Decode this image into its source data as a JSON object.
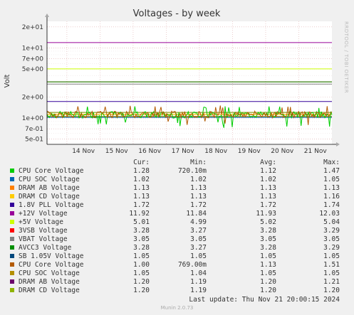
{
  "chart_data": {
    "type": "line",
    "title": "Voltages - by week",
    "ylabel": "Volt",
    "yscale": "log",
    "ylim": [
      0.42,
      24
    ],
    "x_ticks": [
      "14 Nov",
      "15 Nov",
      "16 Nov",
      "17 Nov",
      "18 Nov",
      "19 Nov",
      "20 Nov",
      "21 Nov"
    ],
    "y_ticks": [
      "2e+01",
      "1e+01",
      "7e+00",
      "5e+00",
      "2e+00",
      "1e+00",
      "7e-01",
      "5e-01"
    ],
    "y_tick_values": [
      20,
      10,
      7,
      5,
      2,
      1,
      0.7,
      0.5
    ],
    "series": [
      {
        "name": "CPU Core Voltage",
        "color": "#00cc00",
        "cur": "1.28",
        "min": "720.10m",
        "avg": "1.12",
        "max": "1.47",
        "value": 1.12,
        "noisy": true
      },
      {
        "name": "CPU SOC Voltage",
        "color": "#0066b3",
        "cur": "1.02",
        "min": "1.02",
        "avg": "1.02",
        "max": "1.05",
        "value": 1.02,
        "noisy": false
      },
      {
        "name": "DRAM AB Voltage",
        "color": "#ff8000",
        "cur": "1.13",
        "min": "1.13",
        "avg": "1.13",
        "max": "1.13",
        "value": 1.13,
        "noisy": false
      },
      {
        "name": "DRAM CD Voltage",
        "color": "#ffcc00",
        "cur": "1.13",
        "min": "1.13",
        "avg": "1.13",
        "max": "1.16",
        "value": 1.13,
        "noisy": false
      },
      {
        "name": "1.8V PLL Voltage",
        "color": "#330099",
        "cur": "1.72",
        "min": "1.72",
        "avg": "1.72",
        "max": "1.74",
        "value": 1.72,
        "noisy": false
      },
      {
        "name": "+12V Voltage",
        "color": "#990099",
        "cur": "11.92",
        "min": "11.84",
        "avg": "11.93",
        "max": "12.03",
        "value": 11.93,
        "noisy": false
      },
      {
        "name": "+5V Voltage",
        "color": "#ccff00",
        "cur": "5.01",
        "min": "4.99",
        "avg": "5.02",
        "max": "5.04",
        "value": 5.02,
        "noisy": false
      },
      {
        "name": "3VSB Voltage",
        "color": "#ff0000",
        "cur": "3.28",
        "min": "3.27",
        "avg": "3.28",
        "max": "3.29",
        "value": 3.28,
        "noisy": false
      },
      {
        "name": "VBAT Voltage",
        "color": "#808080",
        "cur": "3.05",
        "min": "3.05",
        "avg": "3.05",
        "max": "3.05",
        "value": 3.05,
        "noisy": false
      },
      {
        "name": "AVCC3 Voltage",
        "color": "#008f00",
        "cur": "3.28",
        "min": "3.27",
        "avg": "3.28",
        "max": "3.29",
        "value": 3.28,
        "noisy": false
      },
      {
        "name": "SB 1.05V Voltage",
        "color": "#00487d",
        "cur": "1.05",
        "min": "1.05",
        "avg": "1.05",
        "max": "1.05",
        "value": 1.05,
        "noisy": false
      },
      {
        "name": "CPU Core Voltage",
        "color": "#b35a00",
        "cur": "1.00",
        "min": "769.00m",
        "avg": "1.13",
        "max": "1.51",
        "value": 1.13,
        "noisy": true
      },
      {
        "name": "CPU SOC Voltage",
        "color": "#b38f00",
        "cur": "1.05",
        "min": "1.04",
        "avg": "1.05",
        "max": "1.05",
        "value": 1.05,
        "noisy": false
      },
      {
        "name": "DRAM AB Voltage",
        "color": "#6b006b",
        "cur": "1.20",
        "min": "1.19",
        "avg": "1.20",
        "max": "1.21",
        "value": 1.2,
        "noisy": false
      },
      {
        "name": "DRAM CD Voltage",
        "color": "#8fb300",
        "cur": "1.20",
        "min": "1.19",
        "avg": "1.20",
        "max": "1.20",
        "value": 1.2,
        "noisy": false
      }
    ]
  },
  "legend_headers": {
    "cur": "Cur:",
    "min": "Min:",
    "avg": "Avg:",
    "max": "Max:"
  },
  "last_update": "Last update: Thu Nov 21 20:00:15 2024",
  "side_label": "RRDTOOL / TOBI OETIKER",
  "footer": "Munin 2.0.73",
  "colors": {
    "background": "#f0f0f0",
    "plot_bg": "#ffffff",
    "grid": "#e0b0b0"
  }
}
